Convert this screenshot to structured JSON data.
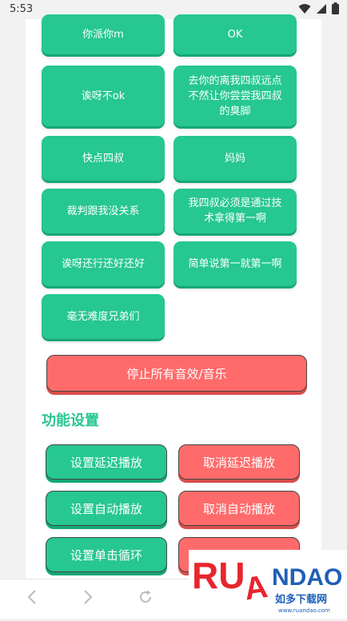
{
  "status": {
    "time": "5:53"
  },
  "sound_tiles": [
    {
      "label": "你派你m"
    },
    {
      "label": "OK"
    },
    {
      "label": "诶呀不ok"
    },
    {
      "label": "去你的离我四叔远点不然让你尝尝我四叔的臭脚"
    },
    {
      "label": "快点四叔"
    },
    {
      "label": "妈妈"
    },
    {
      "label": "裁判跟我没关系"
    },
    {
      "label": "我四叔必须是通过技术拿得第一啊"
    },
    {
      "label": "诶呀还行还好还好"
    },
    {
      "label": "简单说第一就第一啊"
    },
    {
      "label": "毫无难度兄弟们"
    }
  ],
  "stop_all_label": "停止所有音效/音乐",
  "settings": {
    "title": "功能设置",
    "set_delay": "设置延迟播放",
    "cancel_delay": "取消延迟播放",
    "set_auto": "设置自动播放",
    "cancel_auto": "取消自动播放",
    "set_loop": "设置单击循环"
  },
  "watermark": {
    "brand": "RUANDAO",
    "tagline": "如多下载网",
    "url": "www.ruandao.com"
  },
  "colors": {
    "green": "#26c791",
    "red": "#ff6b6b",
    "watermark_red": "#e8262d",
    "watermark_blue": "#1f5fb8"
  }
}
